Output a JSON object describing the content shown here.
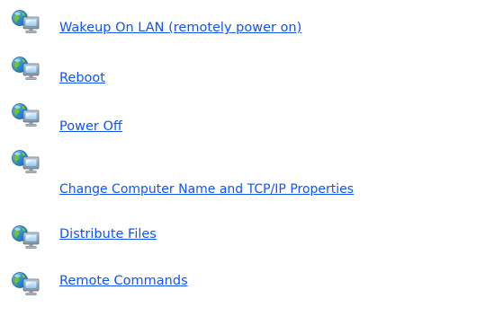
{
  "actions": [
    {
      "label": "Wakeup On LAN (remotely power on)",
      "icon": "network-computer-icon"
    },
    {
      "label": "Reboot",
      "icon": "network-computer-icon"
    },
    {
      "label": "Power Off",
      "icon": "network-computer-icon"
    },
    {
      "label": "Change Computer Name and TCP/IP Properties",
      "icon": "network-computer-icon"
    },
    {
      "label": "Distribute Files",
      "icon": "network-computer-icon"
    },
    {
      "label": "Remote Commands",
      "icon": "network-computer-icon"
    }
  ],
  "colors": {
    "link": "#1155ee",
    "background": "#ffffff"
  }
}
